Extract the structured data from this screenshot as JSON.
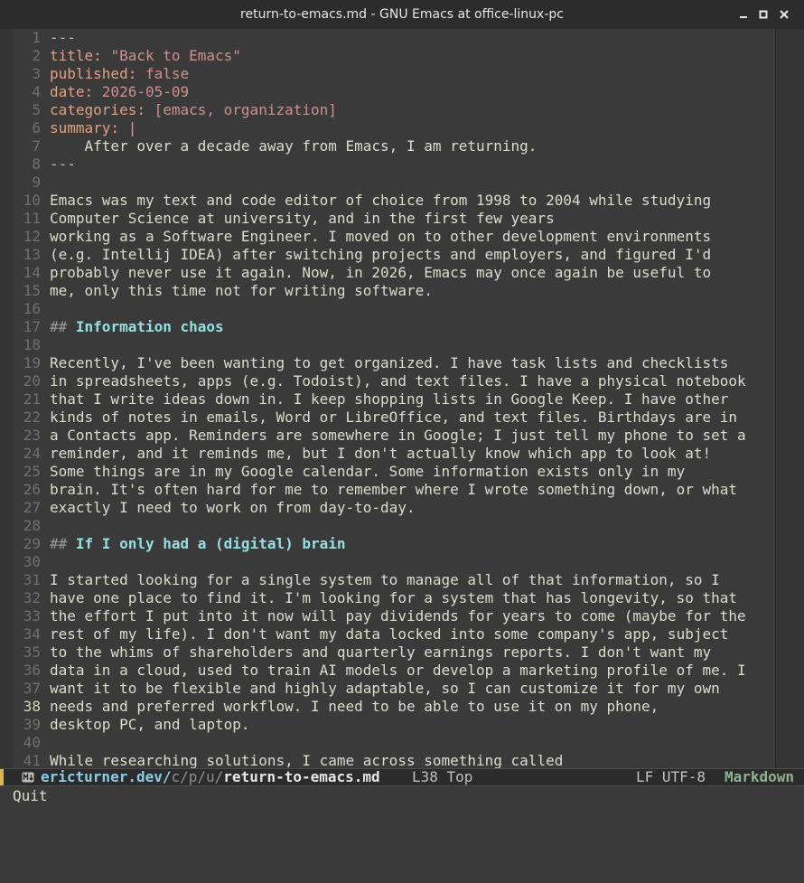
{
  "window": {
    "title": "return-to-emacs.md - GNU Emacs at office-linux-pc",
    "controls": [
      "minimize-icon",
      "maximize-icon",
      "close-icon"
    ]
  },
  "editor": {
    "current_line": 38,
    "lines": [
      {
        "n": "1",
        "segs": [
          {
            "t": "---",
            "c": "dash"
          }
        ]
      },
      {
        "n": "2",
        "segs": [
          {
            "t": "title: ",
            "c": "key"
          },
          {
            "t": "\"Back to Emacs\"",
            "c": "str"
          }
        ]
      },
      {
        "n": "3",
        "segs": [
          {
            "t": "published: ",
            "c": "key"
          },
          {
            "t": "false",
            "c": "str"
          }
        ]
      },
      {
        "n": "4",
        "segs": [
          {
            "t": "date: ",
            "c": "key"
          },
          {
            "t": "2026-05-09",
            "c": "str"
          }
        ]
      },
      {
        "n": "5",
        "segs": [
          {
            "t": "categories: ",
            "c": "key"
          },
          {
            "t": "[emacs, organization]",
            "c": "str"
          }
        ]
      },
      {
        "n": "6",
        "segs": [
          {
            "t": "summary: ",
            "c": "key"
          },
          {
            "t": "|",
            "c": "sym"
          }
        ]
      },
      {
        "n": "7",
        "segs": [
          {
            "t": "    After over a decade away from Emacs, I am returning.",
            "c": ""
          }
        ]
      },
      {
        "n": "8",
        "segs": [
          {
            "t": "---",
            "c": "dash"
          }
        ]
      },
      {
        "n": "9",
        "segs": []
      },
      {
        "n": "10",
        "segs": [
          {
            "t": "Emacs was my text and code editor of choice from 1998 to 2004 while studying",
            "c": ""
          }
        ]
      },
      {
        "n": "11",
        "segs": [
          {
            "t": "Computer Science at university, and in the first few years",
            "c": ""
          }
        ]
      },
      {
        "n": "12",
        "segs": [
          {
            "t": "working as a Software Engineer. I moved on to other development environments",
            "c": ""
          }
        ]
      },
      {
        "n": "13",
        "segs": [
          {
            "t": "(e.g. Intellij IDEA) after switching projects and employers, and figured I'd",
            "c": ""
          }
        ]
      },
      {
        "n": "14",
        "segs": [
          {
            "t": "probably never use it again. Now, in 2026, Emacs may once again be useful to",
            "c": ""
          }
        ]
      },
      {
        "n": "15",
        "segs": [
          {
            "t": "me, only this time not for writing software.",
            "c": ""
          }
        ]
      },
      {
        "n": "16",
        "segs": []
      },
      {
        "n": "17",
        "segs": [
          {
            "t": "## ",
            "c": "h"
          },
          {
            "t": "Information chaos",
            "c": "ht"
          }
        ]
      },
      {
        "n": "18",
        "segs": []
      },
      {
        "n": "19",
        "segs": [
          {
            "t": "Recently, I've been wanting to get organized. I have task lists and checklists",
            "c": ""
          }
        ]
      },
      {
        "n": "20",
        "segs": [
          {
            "t": "in spreadsheets, apps (e.g. Todoist), and text files. I have a physical notebook",
            "c": ""
          }
        ]
      },
      {
        "n": "21",
        "segs": [
          {
            "t": "that I write ideas down in. I keep shopping lists in Google Keep. I have other",
            "c": ""
          }
        ]
      },
      {
        "n": "22",
        "segs": [
          {
            "t": "kinds of notes in emails, Word or LibreOffice, and text files. Birthdays are in",
            "c": ""
          }
        ]
      },
      {
        "n": "23",
        "segs": [
          {
            "t": "a Contacts app. Reminders are somewhere in Google; I just tell my phone to set a",
            "c": ""
          }
        ]
      },
      {
        "n": "24",
        "segs": [
          {
            "t": "reminder, and it reminds me, but I don't actually know which app to look at!",
            "c": ""
          }
        ]
      },
      {
        "n": "25",
        "segs": [
          {
            "t": "Some things are in my Google calendar. Some information exists only in my",
            "c": ""
          }
        ]
      },
      {
        "n": "26",
        "segs": [
          {
            "t": "brain. It's often hard for me to remember where I wrote something down, or what",
            "c": ""
          }
        ]
      },
      {
        "n": "27",
        "segs": [
          {
            "t": "exactly I need to work on from day-to-day.",
            "c": ""
          }
        ]
      },
      {
        "n": "28",
        "segs": []
      },
      {
        "n": "29",
        "segs": [
          {
            "t": "## ",
            "c": "h"
          },
          {
            "t": "If I only had a (digital) brain",
            "c": "ht"
          }
        ]
      },
      {
        "n": "30",
        "segs": []
      },
      {
        "n": "31",
        "segs": [
          {
            "t": "I started looking for a single system to manage all of that information, so I",
            "c": ""
          }
        ]
      },
      {
        "n": "32",
        "segs": [
          {
            "t": "have one place to find it. I'm looking for a system that has longevity, so that",
            "c": ""
          }
        ]
      },
      {
        "n": "33",
        "segs": [
          {
            "t": "the effort I put into it now will pay dividends for years to come (maybe for the",
            "c": ""
          }
        ]
      },
      {
        "n": "34",
        "segs": [
          {
            "t": "rest of my life). I don't want my data locked into some company's app, subject",
            "c": ""
          }
        ]
      },
      {
        "n": "35",
        "segs": [
          {
            "t": "to the whims of shareholders and quarterly earnings reports. I don't want my",
            "c": ""
          }
        ]
      },
      {
        "n": "36",
        "segs": [
          {
            "t": "data in a cloud, used to train AI models or develop a marketing profile of me. I",
            "c": ""
          }
        ]
      },
      {
        "n": "37",
        "segs": [
          {
            "t": "want it to be flexible and highly adaptable, so I can customize it for my own",
            "c": ""
          }
        ]
      },
      {
        "n": "38",
        "segs": [
          {
            "t": "needs and preferred workflow. I need to be able to use it on my phone,",
            "c": ""
          }
        ]
      },
      {
        "n": "39",
        "segs": [
          {
            "t": "desktop PC, and laptop.",
            "c": ""
          }
        ]
      },
      {
        "n": "40",
        "segs": []
      },
      {
        "n": "41",
        "segs": [
          {
            "t": "While researching solutions, I came across something called",
            "c": ""
          }
        ]
      }
    ]
  },
  "modeline": {
    "project": "ericturner.dev/",
    "dir": "c/p/u/",
    "file": "return-to-emacs.md",
    "position": "L38 Top",
    "encoding": "LF UTF-8",
    "mode": "Markdown",
    "icon": "markdown-icon",
    "accent_color": "#d9b45a"
  },
  "echo_area": {
    "message": "Quit"
  }
}
